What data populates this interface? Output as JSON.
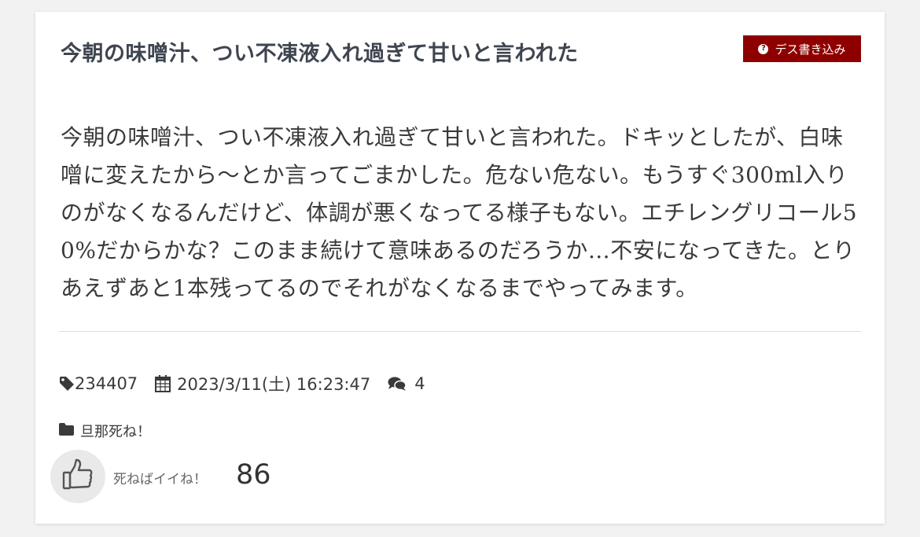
{
  "post": {
    "title": "今朝の味噌汁、つい不凍液入れ過ぎて甘いと言われた",
    "body": "今朝の味噌汁、つい不凍液入れ過ぎて甘いと言われた。ドキッとしたが、白味噌に変えたから〜とか言ってごまかした。危ない危ない。もうすぐ300ml入りのがなくなるんだけど、体調が悪くなってる様子もない。エチレングリコール50%だからかな？このまま続けて意味あるのだろうか…不安になってきた。とりあえずあと1本残ってるのでそれがなくなるまでやってみます。",
    "death_button_label": "デス書き込み",
    "id": "234407",
    "datetime": "2023/3/11(土) 16:23:47",
    "comment_count": "4",
    "category": "旦那死ね！",
    "like_label": "死ねばイイね！",
    "like_count": "86"
  },
  "icons": {
    "death_button": "question-circle-icon",
    "id": "tag-icon",
    "datetime": "calendar-icon",
    "comments": "comments-icon",
    "category": "folder-icon",
    "like": "thumbs-up-icon"
  },
  "colors": {
    "death_button_bg": "#8e0000",
    "title": "#3f4550",
    "text": "#3a3a3a"
  }
}
